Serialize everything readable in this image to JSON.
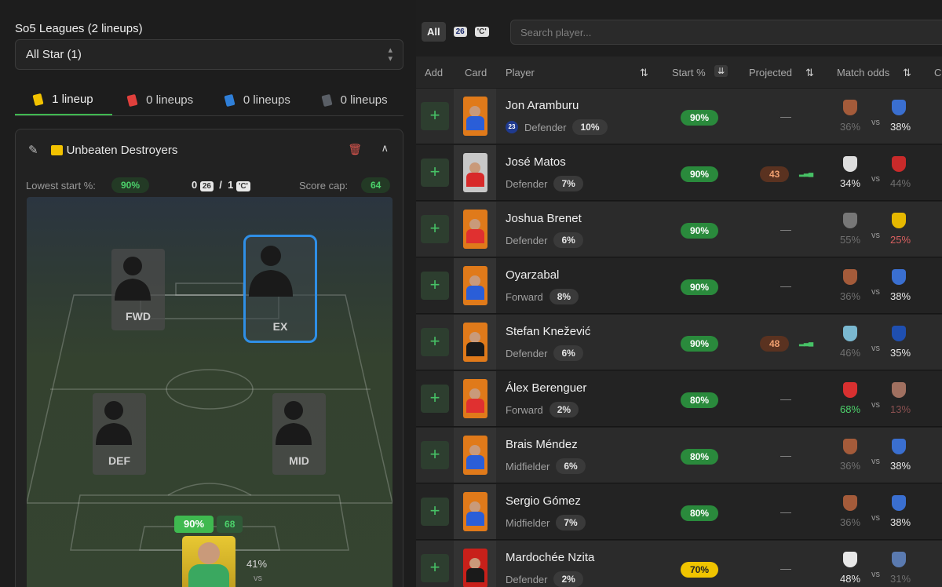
{
  "left": {
    "league_title": "So5 Leagues (2 lineups)",
    "league_select": "All Star (1)",
    "tabs": [
      {
        "label": "1 lineup",
        "color": "#f2c200"
      },
      {
        "label": "0 lineups",
        "color": "#e0403c"
      },
      {
        "label": "0 lineups",
        "color": "#2f7fd8"
      },
      {
        "label": "0 lineups",
        "color": "#5a5f66"
      }
    ],
    "team": {
      "name": "Unbeaten Destroyers",
      "lowest_start_label": "Lowest start %:",
      "lowest_start_value": "90%",
      "count_a": "0",
      "badge_a": "26",
      "sep": "/",
      "count_b": "1",
      "badge_b": "'C'",
      "score_cap_label": "Score cap:",
      "score_cap_value": "64"
    },
    "pitch": {
      "slots": [
        "FWD",
        "EX",
        "DEF",
        "MID"
      ],
      "gk_start": "90%",
      "gk_proj": "68",
      "gk_odds": "41%",
      "gk_vs": "vs"
    }
  },
  "right": {
    "filters": {
      "all": "All",
      "badge_26": "26",
      "badge_c": "'C'"
    },
    "search_placeholder": "Search player...",
    "headers": {
      "add": "Add",
      "card": "Card",
      "player": "Player",
      "start": "Start %",
      "projected": "Projected",
      "odds": "Match odds",
      "more": "C"
    },
    "rows": [
      {
        "name": "Jon Aramburu",
        "role": "Defender",
        "own": "10%",
        "start": "90%",
        "start_color": "g",
        "proj": "",
        "home_odds": "36%",
        "home_cls": "dim",
        "away_odds": "38%",
        "away_cls": "hi",
        "card_color": "#e07a1a",
        "kit": "#2a5ed8",
        "home_club": "#a45b3a",
        "away_club": "#3a6fd0",
        "num": "23"
      },
      {
        "name": "José Matos",
        "role": "Defender",
        "own": "7%",
        "start": "90%",
        "start_color": "g",
        "proj": "43",
        "home_odds": "34%",
        "home_cls": "hi",
        "away_odds": "44%",
        "away_cls": "dim",
        "card_color": "#c8c8c8",
        "kit": "#d82a2a",
        "home_club": "#dddddd",
        "away_club": "#c82a2a"
      },
      {
        "name": "Joshua Brenet",
        "role": "Defender",
        "own": "6%",
        "start": "90%",
        "start_color": "g",
        "proj": "",
        "home_odds": "55%",
        "home_cls": "dim",
        "away_odds": "25%",
        "away_cls": "red",
        "card_color": "#e07a1a",
        "kit": "#e03030",
        "home_club": "#777777",
        "away_club": "#e6b800"
      },
      {
        "name": "Oyarzabal",
        "role": "Forward",
        "own": "8%",
        "start": "90%",
        "start_color": "g",
        "proj": "",
        "home_odds": "36%",
        "home_cls": "dim",
        "away_odds": "38%",
        "away_cls": "hi",
        "card_color": "#e07a1a",
        "kit": "#2a5ed8",
        "home_club": "#a45b3a",
        "away_club": "#3a6fd0"
      },
      {
        "name": "Stefan Knežević",
        "role": "Defender",
        "own": "6%",
        "start": "90%",
        "start_color": "g",
        "proj": "48",
        "home_odds": "46%",
        "home_cls": "dim",
        "away_odds": "35%",
        "away_cls": "hi",
        "card_color": "#e07a1a",
        "kit": "#1a1a1a",
        "home_club": "#7ab8d0",
        "away_club": "#1f4fb0"
      },
      {
        "name": "Álex Berenguer",
        "role": "Forward",
        "own": "2%",
        "start": "80%",
        "start_color": "g",
        "proj": "",
        "home_odds": "68%",
        "home_cls": "green",
        "away_odds": "13%",
        "away_cls": "redim",
        "card_color": "#e07a1a",
        "kit": "#e03030",
        "home_club": "#d83030",
        "away_club": "#a07060"
      },
      {
        "name": "Brais Méndez",
        "role": "Midfielder",
        "own": "6%",
        "start": "80%",
        "start_color": "g",
        "proj": "",
        "home_odds": "36%",
        "home_cls": "dim",
        "away_odds": "38%",
        "away_cls": "hi",
        "card_color": "#e07a1a",
        "kit": "#2a5ed8",
        "home_club": "#a45b3a",
        "away_club": "#3a6fd0"
      },
      {
        "name": "Sergio Gómez",
        "role": "Midfielder",
        "own": "7%",
        "start": "80%",
        "start_color": "g",
        "proj": "",
        "home_odds": "36%",
        "home_cls": "dim",
        "away_odds": "38%",
        "away_cls": "hi",
        "card_color": "#e07a1a",
        "kit": "#2a5ed8",
        "home_club": "#a45b3a",
        "away_club": "#3a6fd0"
      },
      {
        "name": "Mardochée Nzita",
        "role": "Defender",
        "own": "2%",
        "start": "70%",
        "start_color": "y",
        "proj": "",
        "home_odds": "48%",
        "home_cls": "hi",
        "away_odds": "31%",
        "away_cls": "dim",
        "card_color": "#c8201a",
        "kit": "#1a1a1a",
        "home_club": "#e8e8e8",
        "away_club": "#5a7ab0"
      }
    ]
  }
}
